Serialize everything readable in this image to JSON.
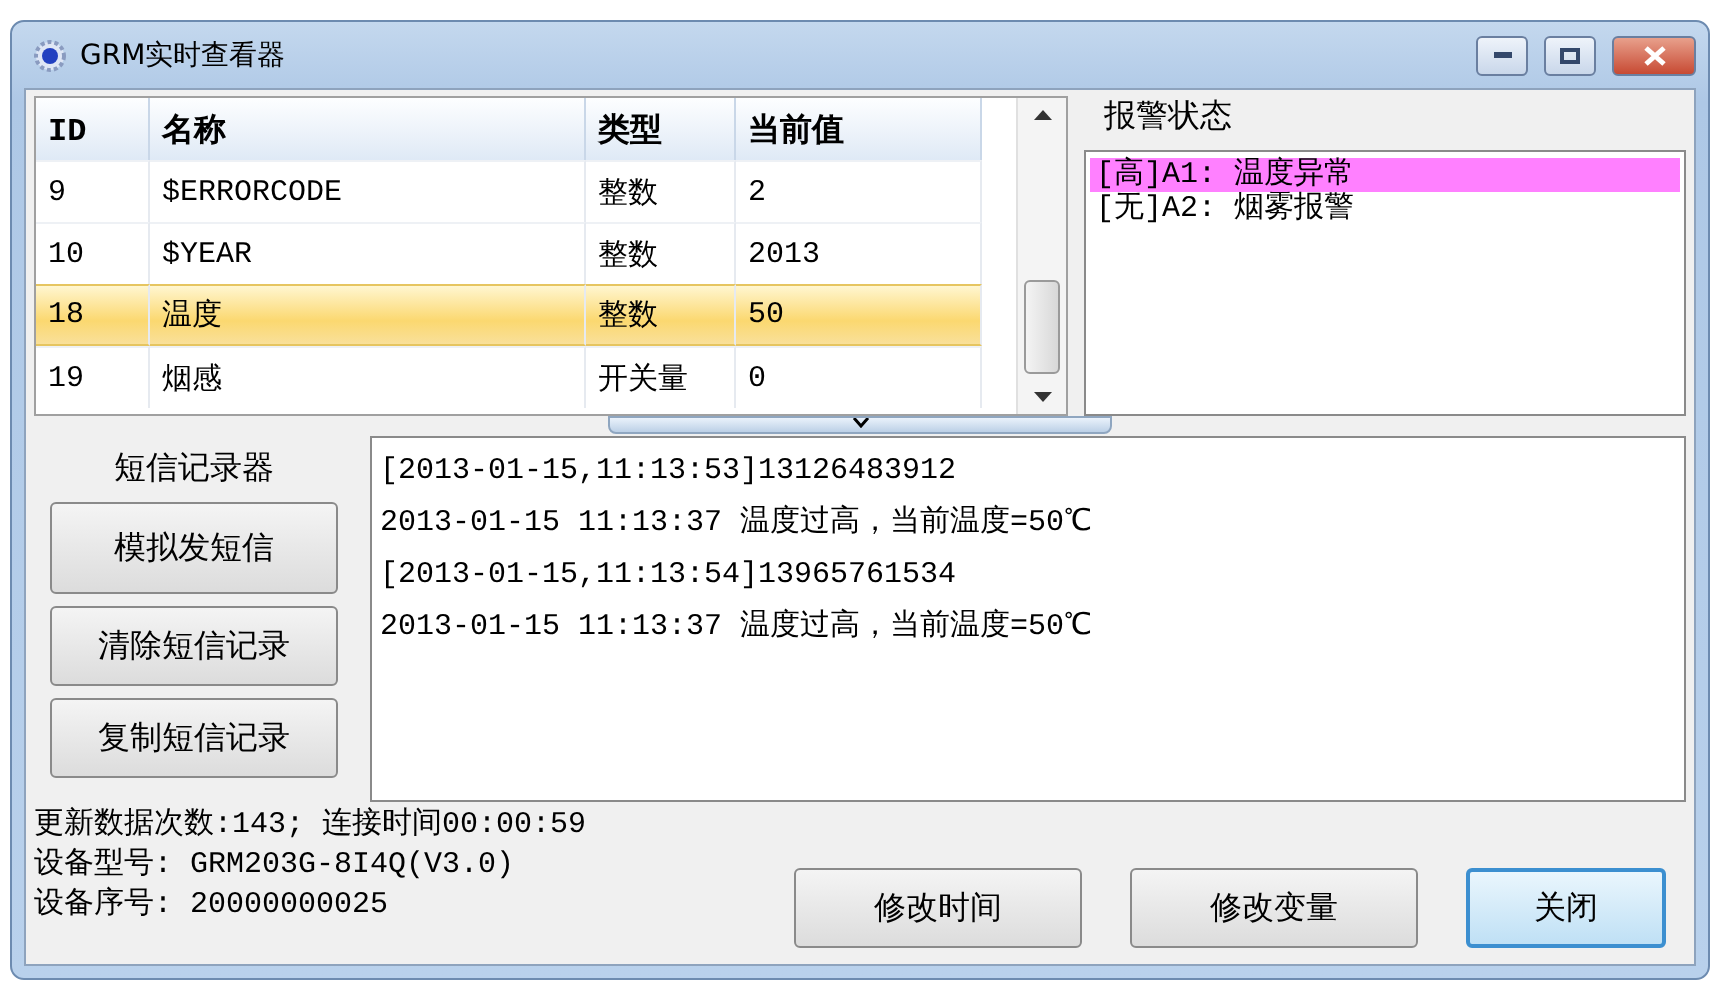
{
  "window": {
    "title": "GRM实时查看器"
  },
  "table": {
    "columns": [
      "ID",
      "名称",
      "类型",
      "当前值"
    ],
    "rows": [
      {
        "cells": [
          "9",
          "$ERRORCODE",
          "整数",
          "2"
        ],
        "selected": false
      },
      {
        "cells": [
          "10",
          "$YEAR",
          "整数",
          "2013"
        ],
        "selected": false
      },
      {
        "cells": [
          "18",
          "温度",
          "整数",
          "50"
        ],
        "selected": true
      },
      {
        "cells": [
          "19",
          "烟感",
          "开关量",
          "0"
        ],
        "selected": false
      }
    ]
  },
  "alarm_panel": {
    "title": "报警状态",
    "items": [
      {
        "text": "[高]A1: 温度异常",
        "color": "#ff80ff"
      },
      {
        "text": "[无]A2: 烟雾报警",
        "color": "#ffffff"
      }
    ]
  },
  "sms_recorder": {
    "title": "短信记录器",
    "buttons": [
      "模拟发短信",
      "清除短信记录",
      "复制短信记录"
    ],
    "log": [
      "[2013-01-15,11:13:53]13126483912",
      "2013-01-15 11:13:37 温度过高，当前温度=50℃",
      "[2013-01-15,11:13:54]13965761534",
      "2013-01-15 11:13:37 温度过高，当前温度=50℃"
    ]
  },
  "status": [
    "更新数据次数:143; 连接时间00:00:59",
    "设备型号: GRM203G-8I4Q(V3.0)",
    "设备序号: 20000000025"
  ],
  "buttons": [
    {
      "label": "修改时间",
      "focused": false
    },
    {
      "label": "修改变量",
      "focused": false
    },
    {
      "label": "关闭",
      "focused": true
    }
  ]
}
